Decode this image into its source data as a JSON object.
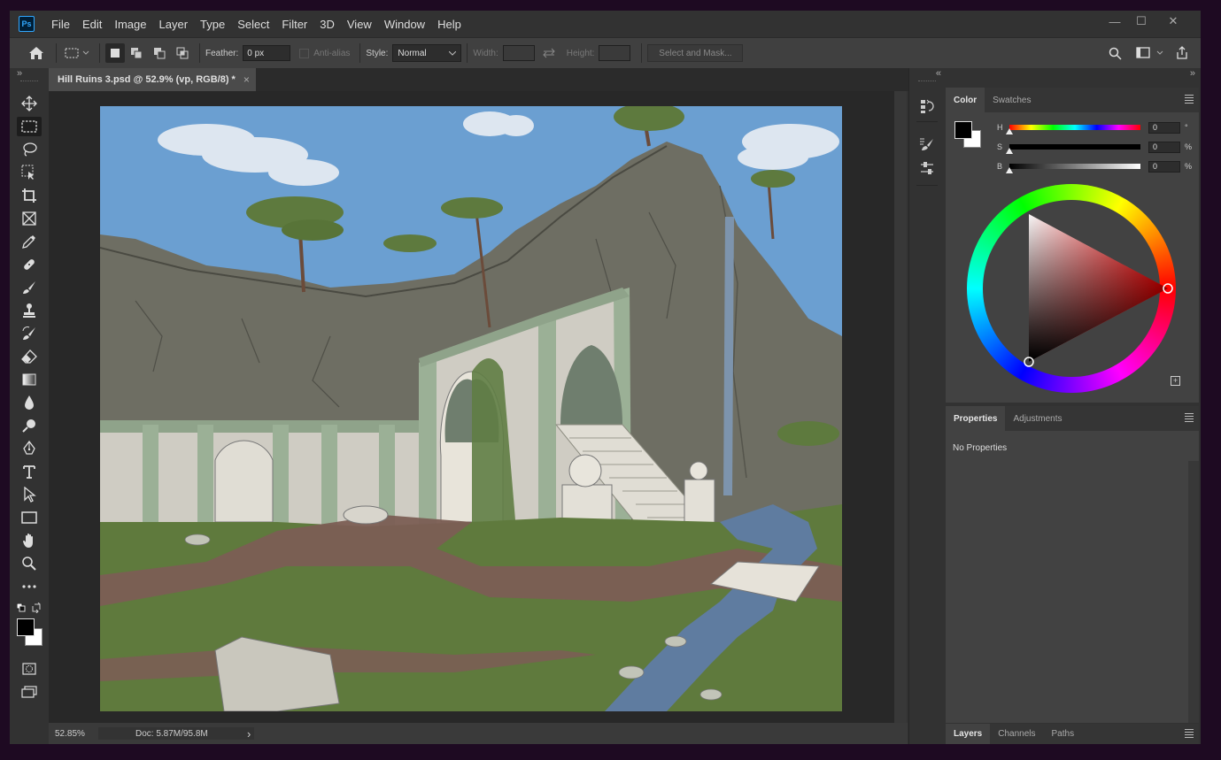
{
  "app": {
    "logo_text": "Ps"
  },
  "menu": [
    "File",
    "Edit",
    "Image",
    "Layer",
    "Type",
    "Select",
    "Filter",
    "3D",
    "View",
    "Window",
    "Help"
  ],
  "window_controls": {
    "minimize": "—",
    "maximize": "☐",
    "close": "✕"
  },
  "options": {
    "feather_label": "Feather:",
    "feather_value": "0 px",
    "antialias_label": "Anti-alias",
    "style_label": "Style:",
    "style_value": "Normal",
    "width_label": "Width:",
    "height_label": "Height:",
    "select_mask_label": "Select and Mask..."
  },
  "document": {
    "tab_title": "Hill Ruins 3.psd @ 52.9% (vp, RGB/8) *",
    "close": "×"
  },
  "status": {
    "zoom": "52.85%",
    "doc": "Doc: 5.87M/95.8M",
    "arrow": "›"
  },
  "color_panel": {
    "tabs": [
      "Color",
      "Swatches"
    ],
    "h_label": "H",
    "h_value": "0",
    "h_unit": "°",
    "s_label": "S",
    "s_value": "0",
    "s_unit": "%",
    "b_label": "B",
    "b_value": "0",
    "b_unit": "%",
    "hue_marker_color": "#ff0000"
  },
  "properties_panel": {
    "tabs": [
      "Properties",
      "Adjustments"
    ],
    "empty_text": "No Properties"
  },
  "layers_panel": {
    "tabs": [
      "Layers",
      "Channels",
      "Paths"
    ]
  },
  "collapse": "»",
  "expand": "«",
  "colors": {
    "accent": "#31a8ff",
    "foreground": "#000000",
    "background": "#ffffff"
  }
}
